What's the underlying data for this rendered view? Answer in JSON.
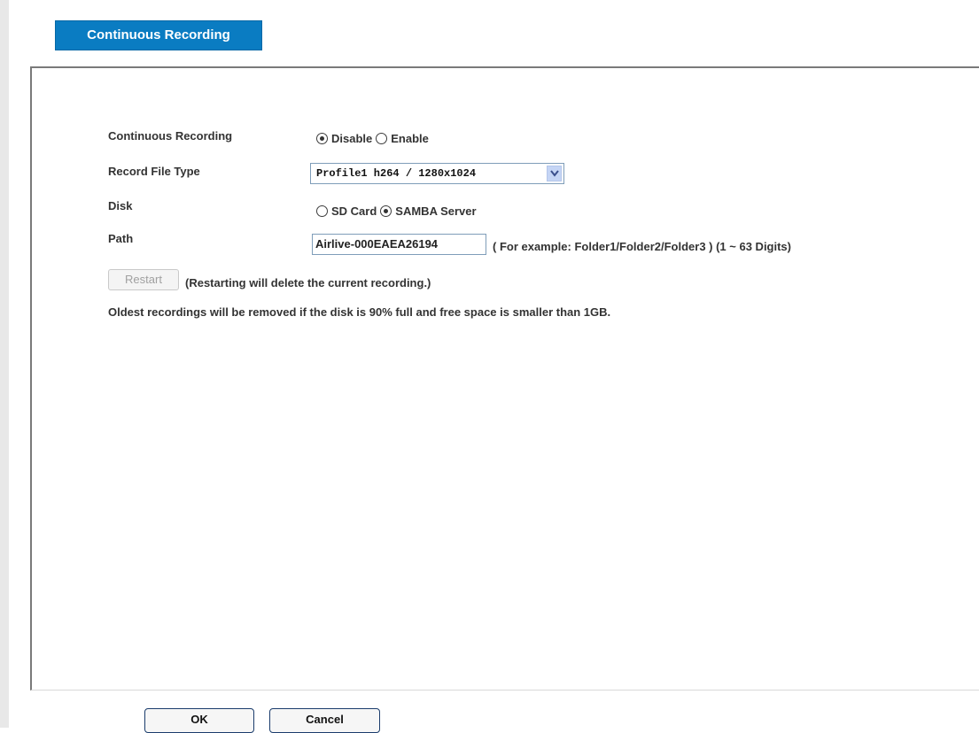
{
  "tab": {
    "label": "Continuous Recording"
  },
  "form": {
    "continuous_recording": {
      "label": "Continuous Recording",
      "options": [
        {
          "label": "Disable",
          "checked": true
        },
        {
          "label": "Enable",
          "checked": false
        }
      ]
    },
    "record_file_type": {
      "label": "Record File Type",
      "selected": "Profile1 h264 / 1280x1024"
    },
    "disk": {
      "label": "Disk",
      "options": [
        {
          "label": "SD Card",
          "checked": false
        },
        {
          "label": "SAMBA Server",
          "checked": true
        }
      ]
    },
    "path": {
      "label": "Path",
      "value": "Airlive-000EAEA26194",
      "hint": "( For example: Folder1/Folder2/Folder3 ) (1 ~ 63 Digits)"
    },
    "restart": {
      "label": "Restart",
      "note": "(Restarting will delete the current recording.)"
    },
    "oldest_note": "Oldest recordings will be removed if the disk is 90% full and free space is smaller than 1GB."
  },
  "footer": {
    "ok_label": "OK",
    "cancel_label": "Cancel"
  },
  "colors": {
    "tab_background": "#0a7cc2",
    "select_arrow": "#c5d5f5"
  }
}
